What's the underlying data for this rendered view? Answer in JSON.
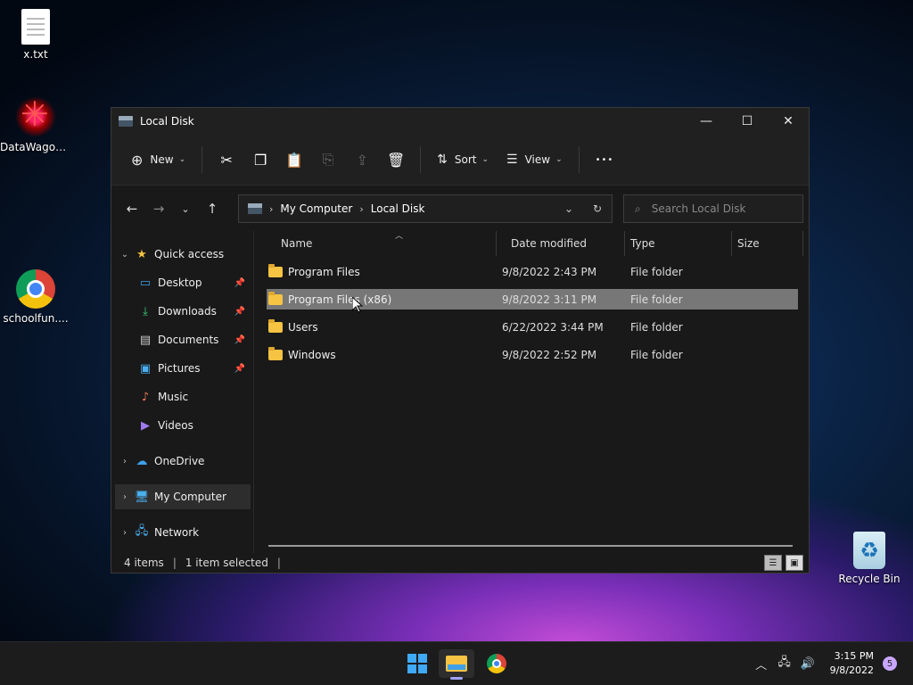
{
  "desktop": {
    "icons": [
      {
        "label": "x.txt"
      },
      {
        "label": "DataWagon..."
      },
      {
        "label": "schoolfun...."
      },
      {
        "label": "Recycle Bin"
      }
    ]
  },
  "window": {
    "title": "Local Disk",
    "toolbar": {
      "new_label": "New",
      "sort_label": "Sort",
      "view_label": "View",
      "more_label": "•••"
    },
    "address": {
      "crumbs": [
        "My Computer",
        "Local Disk"
      ],
      "search_placeholder": "Search Local Disk"
    },
    "nav": {
      "quick_access": "Quick access",
      "pinned": [
        "Desktop",
        "Downloads",
        "Documents",
        "Pictures"
      ],
      "other": [
        "Music",
        "Videos"
      ],
      "onedrive": "OneDrive",
      "my_computer": "My Computer",
      "network": "Network"
    },
    "columns": [
      "Name",
      "Date modified",
      "Type",
      "Size"
    ],
    "files": [
      {
        "name": "Program Files",
        "date": "9/8/2022 2:43 PM",
        "type": "File folder",
        "size": ""
      },
      {
        "name": "Program Files (x86)",
        "date": "9/8/2022 3:11 PM",
        "type": "File folder",
        "size": ""
      },
      {
        "name": "Users",
        "date": "6/22/2022 3:44 PM",
        "type": "File folder",
        "size": ""
      },
      {
        "name": "Windows",
        "date": "9/8/2022 2:52 PM",
        "type": "File folder",
        "size": ""
      }
    ],
    "status": {
      "items": "4 items",
      "selected": "1 item selected"
    }
  },
  "taskbar": {
    "time": "3:15 PM",
    "date": "9/8/2022",
    "notifications": "5"
  },
  "colors": {
    "selected_row": "#777777",
    "window_bg": "#191919",
    "accent": "#9ea3ff"
  }
}
